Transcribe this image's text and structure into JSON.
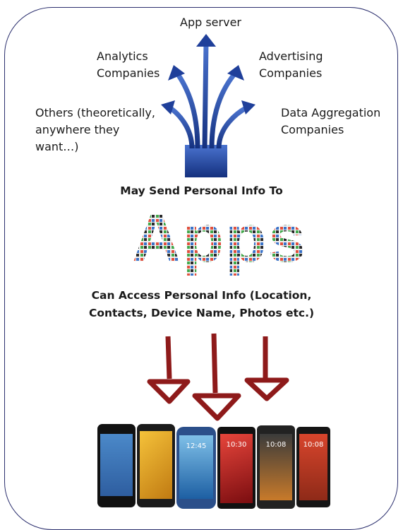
{
  "destinations": {
    "app_server": "App server",
    "analytics": "Analytics\nCompanies",
    "advertising": "Advertising\nCompanies",
    "others": "Others (theoretically,\nanywhere they\nwant…)",
    "data_aggregation": "Data Aggregation\nCompanies"
  },
  "send_caption": "May Send Personal Info To",
  "apps_word": "Apps",
  "access_caption": "Can Access Personal Info (Location,\nContacts, Device Name, Photos etc.)",
  "phones": [
    {
      "screen_text": ""
    },
    {
      "screen_text": ""
    },
    {
      "screen_text": "12:45"
    },
    {
      "screen_text": "10:30"
    },
    {
      "screen_text": "10:08"
    },
    {
      "screen_text": "10:08"
    }
  ],
  "colors": {
    "frame": "#2b2f6e",
    "arrows_up": "#1f3f9a",
    "arrows_down": "#8e1a1a"
  }
}
